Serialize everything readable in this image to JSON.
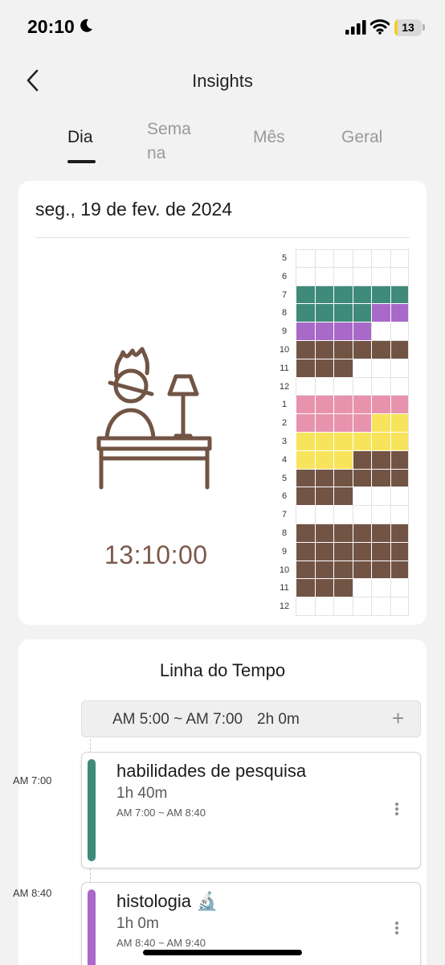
{
  "status_bar": {
    "time": "20:10",
    "battery": "13",
    "battery_fraction": 0.13
  },
  "header": {
    "title": "Insights"
  },
  "tabs": [
    {
      "label": "Dia",
      "active": true
    },
    {
      "label": "Sema\nna",
      "active": false
    },
    {
      "label": "Mês",
      "active": false
    },
    {
      "label": "Geral",
      "active": false
    }
  ],
  "day_card": {
    "date": "seg., 19 de fev. de 2024",
    "timer": "13:10:00",
    "hour_labels": [
      "5",
      "6",
      "7",
      "8",
      "9",
      "10",
      "11",
      "12",
      "1",
      "2",
      "3",
      "4",
      "5",
      "6",
      "7",
      "8",
      "9",
      "10",
      "11",
      "12"
    ],
    "palette": {
      "T": "#3f8a7a",
      "P": "#a869c8",
      "B": "#725445",
      "K": "#e893ad",
      "Y": "#f8e45c"
    },
    "hour_grid": [
      "......",
      "......",
      "TTTTTT",
      "TTTTPP",
      "PPPP..",
      "BBBBBB",
      "BBB...",
      "......",
      "KKKKKK",
      "KKKKYY",
      "YYYYYY",
      "YYYBBB",
      "BBBBBB",
      "BBB...",
      "......",
      "BBBBBB",
      "BBBBBB",
      "BBBBBB",
      "BBB...",
      "......"
    ]
  },
  "timeline": {
    "title": "Linha do Tempo",
    "empty_slot": {
      "range": "AM 5:00 ~ AM 7:00",
      "duration": "2h 0m",
      "add": "+"
    },
    "entries": [
      {
        "time": "AM 7:00",
        "name": "habilidades de pesquisa",
        "duration": "1h 40m",
        "range": "AM 7:00 ~ AM 8:40",
        "color": "#3f8a7a"
      },
      {
        "time": "AM 8:40",
        "name": "histologia 🔬",
        "duration": "1h 0m",
        "range": "AM 8:40 ~ AM 9:40",
        "color": "#a869c8"
      }
    ]
  }
}
